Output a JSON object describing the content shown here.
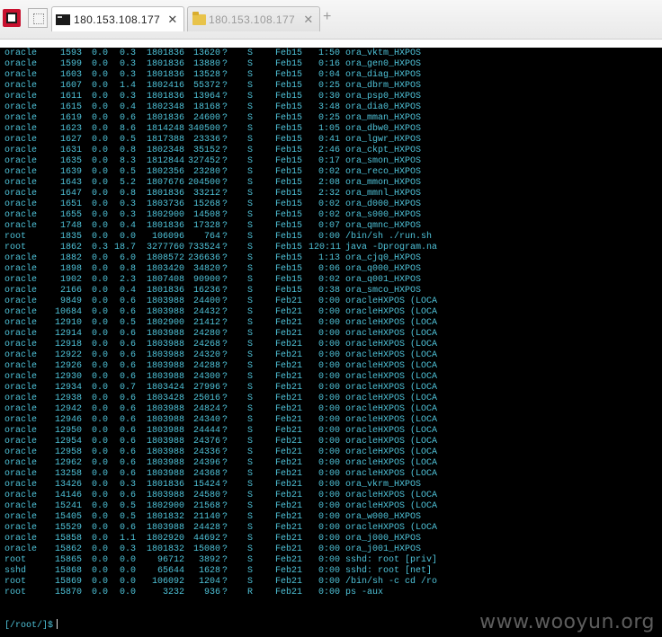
{
  "tabs": [
    {
      "label": "180.153.108.177",
      "icon": "terminal-icon",
      "active": true
    },
    {
      "label": "180.153.108.177",
      "icon": "folder-icon",
      "active": false
    }
  ],
  "glyphs": {
    "close": "✕",
    "new_tab": "+"
  },
  "terminal": {
    "rows": [
      [
        "oracle",
        "1593",
        "0.0",
        "0.3",
        "1801836",
        "13620",
        "?",
        "S",
        "Feb15",
        "1:50",
        "ora_vktm_HXPOS"
      ],
      [
        "oracle",
        "1599",
        "0.0",
        "0.3",
        "1801836",
        "13880",
        "?",
        "S",
        "Feb15",
        "0:16",
        "ora_gen0_HXPOS"
      ],
      [
        "oracle",
        "1603",
        "0.0",
        "0.3",
        "1801836",
        "13528",
        "?",
        "S",
        "Feb15",
        "0:04",
        "ora_diag_HXPOS"
      ],
      [
        "oracle",
        "1607",
        "0.0",
        "1.4",
        "1802416",
        "55372",
        "?",
        "S",
        "Feb15",
        "0:25",
        "ora_dbrm_HXPOS"
      ],
      [
        "oracle",
        "1611",
        "0.0",
        "0.3",
        "1801836",
        "13964",
        "?",
        "S",
        "Feb15",
        "0:30",
        "ora_psp0_HXPOS"
      ],
      [
        "oracle",
        "1615",
        "0.0",
        "0.4",
        "1802348",
        "18168",
        "?",
        "S",
        "Feb15",
        "3:48",
        "ora_dia0_HXPOS"
      ],
      [
        "oracle",
        "1619",
        "0.0",
        "0.6",
        "1801836",
        "24600",
        "?",
        "S",
        "Feb15",
        "0:25",
        "ora_mman_HXPOS"
      ],
      [
        "oracle",
        "1623",
        "0.0",
        "8.6",
        "1814248",
        "340500",
        "?",
        "S",
        "Feb15",
        "1:05",
        "ora_dbw0_HXPOS"
      ],
      [
        "oracle",
        "1627",
        "0.0",
        "0.5",
        "1817388",
        "23336",
        "?",
        "S",
        "Feb15",
        "0:41",
        "ora_lgwr_HXPOS"
      ],
      [
        "oracle",
        "1631",
        "0.0",
        "0.8",
        "1802348",
        "35152",
        "?",
        "S",
        "Feb15",
        "2:46",
        "ora_ckpt_HXPOS"
      ],
      [
        "oracle",
        "1635",
        "0.0",
        "8.3",
        "1812844",
        "327452",
        "?",
        "S",
        "Feb15",
        "0:17",
        "ora_smon_HXPOS"
      ],
      [
        "oracle",
        "1639",
        "0.0",
        "0.5",
        "1802356",
        "23280",
        "?",
        "S",
        "Feb15",
        "0:02",
        "ora_reco_HXPOS"
      ],
      [
        "oracle",
        "1643",
        "0.0",
        "5.2",
        "1807676",
        "204500",
        "?",
        "S",
        "Feb15",
        "2:08",
        "ora_mmon_HXPOS"
      ],
      [
        "oracle",
        "1647",
        "0.0",
        "0.8",
        "1801836",
        "33212",
        "?",
        "S",
        "Feb15",
        "2:32",
        "ora_mmnl_HXPOS"
      ],
      [
        "oracle",
        "1651",
        "0.0",
        "0.3",
        "1803736",
        "15268",
        "?",
        "S",
        "Feb15",
        "0:02",
        "ora_d000_HXPOS"
      ],
      [
        "oracle",
        "1655",
        "0.0",
        "0.3",
        "1802900",
        "14508",
        "?",
        "S",
        "Feb15",
        "0:02",
        "ora_s000_HXPOS"
      ],
      [
        "oracle",
        "1748",
        "0.0",
        "0.4",
        "1801836",
        "17328",
        "?",
        "S",
        "Feb15",
        "0:07",
        "ora_qmnc_HXPOS"
      ],
      [
        "root",
        "1835",
        "0.0",
        "0.0",
        "106096",
        "764",
        "?",
        "S",
        "Feb15",
        "0:00",
        "/bin/sh ./run.sh"
      ],
      [
        "root",
        "1862",
        "0.3",
        "18.7",
        "3277760",
        "733524",
        "?",
        "S",
        "Feb15",
        "120:11",
        "java -Dprogram.na"
      ],
      [
        "oracle",
        "1882",
        "0.0",
        "6.0",
        "1808572",
        "236636",
        "?",
        "S",
        "Feb15",
        "1:13",
        "ora_cjq0_HXPOS"
      ],
      [
        "oracle",
        "1898",
        "0.0",
        "0.8",
        "1803420",
        "34820",
        "?",
        "S",
        "Feb15",
        "0:06",
        "ora_q000_HXPOS"
      ],
      [
        "oracle",
        "1902",
        "0.0",
        "2.3",
        "1807408",
        "90900",
        "?",
        "S",
        "Feb15",
        "0:02",
        "ora_q001_HXPOS"
      ],
      [
        "oracle",
        "2166",
        "0.0",
        "0.4",
        "1801836",
        "16236",
        "?",
        "S",
        "Feb15",
        "0:38",
        "ora_smco_HXPOS"
      ],
      [
        "oracle",
        "9849",
        "0.0",
        "0.6",
        "1803988",
        "24400",
        "?",
        "S",
        "Feb21",
        "0:00",
        "oracleHXPOS (LOCA"
      ],
      [
        "oracle",
        "10684",
        "0.0",
        "0.6",
        "1803988",
        "24432",
        "?",
        "S",
        "Feb21",
        "0:00",
        "oracleHXPOS (LOCA"
      ],
      [
        "oracle",
        "12910",
        "0.0",
        "0.5",
        "1802900",
        "21412",
        "?",
        "S",
        "Feb21",
        "0:00",
        "oracleHXPOS (LOCA"
      ],
      [
        "oracle",
        "12914",
        "0.0",
        "0.6",
        "1803988",
        "24280",
        "?",
        "S",
        "Feb21",
        "0:00",
        "oracleHXPOS (LOCA"
      ],
      [
        "oracle",
        "12918",
        "0.0",
        "0.6",
        "1803988",
        "24268",
        "?",
        "S",
        "Feb21",
        "0:00",
        "oracleHXPOS (LOCA"
      ],
      [
        "oracle",
        "12922",
        "0.0",
        "0.6",
        "1803988",
        "24320",
        "?",
        "S",
        "Feb21",
        "0:00",
        "oracleHXPOS (LOCA"
      ],
      [
        "oracle",
        "12926",
        "0.0",
        "0.6",
        "1803988",
        "24288",
        "?",
        "S",
        "Feb21",
        "0:00",
        "oracleHXPOS (LOCA"
      ],
      [
        "oracle",
        "12930",
        "0.0",
        "0.6",
        "1803988",
        "24300",
        "?",
        "S",
        "Feb21",
        "0:00",
        "oracleHXPOS (LOCA"
      ],
      [
        "oracle",
        "12934",
        "0.0",
        "0.7",
        "1803424",
        "27996",
        "?",
        "S",
        "Feb21",
        "0:00",
        "oracleHXPOS (LOCA"
      ],
      [
        "oracle",
        "12938",
        "0.0",
        "0.6",
        "1803428",
        "25016",
        "?",
        "S",
        "Feb21",
        "0:00",
        "oracleHXPOS (LOCA"
      ],
      [
        "oracle",
        "12942",
        "0.0",
        "0.6",
        "1803988",
        "24824",
        "?",
        "S",
        "Feb21",
        "0:00",
        "oracleHXPOS (LOCA"
      ],
      [
        "oracle",
        "12946",
        "0.0",
        "0.6",
        "1803988",
        "24340",
        "?",
        "S",
        "Feb21",
        "0:00",
        "oracleHXPOS (LOCA"
      ],
      [
        "oracle",
        "12950",
        "0.0",
        "0.6",
        "1803988",
        "24444",
        "?",
        "S",
        "Feb21",
        "0:00",
        "oracleHXPOS (LOCA"
      ],
      [
        "oracle",
        "12954",
        "0.0",
        "0.6",
        "1803988",
        "24376",
        "?",
        "S",
        "Feb21",
        "0:00",
        "oracleHXPOS (LOCA"
      ],
      [
        "oracle",
        "12958",
        "0.0",
        "0.6",
        "1803988",
        "24336",
        "?",
        "S",
        "Feb21",
        "0:00",
        "oracleHXPOS (LOCA"
      ],
      [
        "oracle",
        "12962",
        "0.0",
        "0.6",
        "1803988",
        "24396",
        "?",
        "S",
        "Feb21",
        "0:00",
        "oracleHXPOS (LOCA"
      ],
      [
        "oracle",
        "13258",
        "0.0",
        "0.6",
        "1803988",
        "24368",
        "?",
        "S",
        "Feb21",
        "0:00",
        "oracleHXPOS (LOCA"
      ],
      [
        "oracle",
        "13426",
        "0.0",
        "0.3",
        "1801836",
        "15424",
        "?",
        "S",
        "Feb21",
        "0:00",
        "ora_vkrm_HXPOS"
      ],
      [
        "oracle",
        "14146",
        "0.0",
        "0.6",
        "1803988",
        "24580",
        "?",
        "S",
        "Feb21",
        "0:00",
        "oracleHXPOS (LOCA"
      ],
      [
        "oracle",
        "15241",
        "0.0",
        "0.5",
        "1802900",
        "21568",
        "?",
        "S",
        "Feb21",
        "0:00",
        "oracleHXPOS (LOCA"
      ],
      [
        "oracle",
        "15405",
        "0.0",
        "0.5",
        "1801832",
        "21140",
        "?",
        "S",
        "Feb21",
        "0:00",
        "ora_w000_HXPOS"
      ],
      [
        "oracle",
        "15529",
        "0.0",
        "0.6",
        "1803988",
        "24428",
        "?",
        "S",
        "Feb21",
        "0:00",
        "oracleHXPOS (LOCA"
      ],
      [
        "oracle",
        "15858",
        "0.0",
        "1.1",
        "1802920",
        "44692",
        "?",
        "S",
        "Feb21",
        "0:00",
        "ora_j000_HXPOS"
      ],
      [
        "oracle",
        "15862",
        "0.0",
        "0.3",
        "1801832",
        "15080",
        "?",
        "S",
        "Feb21",
        "0:00",
        "ora_j001_HXPOS"
      ],
      [
        "root",
        "15865",
        "0.0",
        "0.0",
        "96712",
        "3892",
        "?",
        "S",
        "Feb21",
        "0:00",
        "sshd: root [priv]"
      ],
      [
        "sshd",
        "15868",
        "0.0",
        "0.0",
        "65644",
        "1628",
        "?",
        "S",
        "Feb21",
        "0:00",
        "sshd: root [net]"
      ],
      [
        "root",
        "15869",
        "0.0",
        "0.0",
        "106092",
        "1204",
        "?",
        "S",
        "Feb21",
        "0:00",
        "/bin/sh -c cd /ro"
      ],
      [
        "root",
        "15870",
        "0.0",
        "0.0",
        "3232",
        "936",
        "?",
        "R",
        "Feb21",
        "0:00",
        "ps -aux"
      ]
    ],
    "prompt": "[/root/]$"
  },
  "watermark": "www.wooyun.org"
}
